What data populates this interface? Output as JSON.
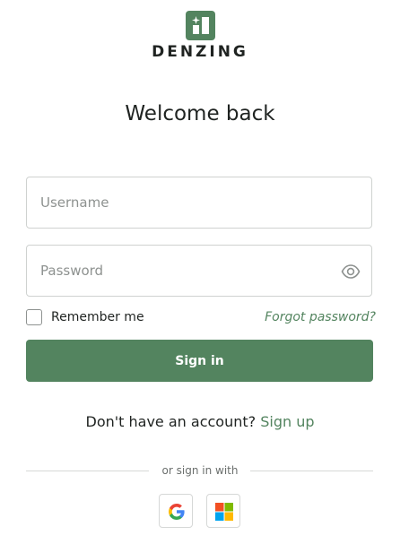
{
  "brand": {
    "name": "DENZING",
    "logo_icon": "brand-logo-icon",
    "color": "#53845f"
  },
  "header": {
    "title": "Welcome back"
  },
  "form": {
    "username_placeholder": "Username",
    "password_placeholder": "Password",
    "password_toggle_icon": "eye-icon",
    "remember_label": "Remember me",
    "remember_checked": false,
    "forgot_label": "Forgot password?",
    "submit_label": "Sign in"
  },
  "signup": {
    "prompt": "Don't have an account?",
    "link_label": "Sign up"
  },
  "social": {
    "divider_label": "or sign in with",
    "providers": [
      {
        "name": "Google",
        "icon": "google-icon"
      },
      {
        "name": "Microsoft",
        "icon": "microsoft-icon"
      }
    ]
  },
  "colors": {
    "accent": "#53845f",
    "text": "#1f2321",
    "border": "#cfd2d0"
  }
}
